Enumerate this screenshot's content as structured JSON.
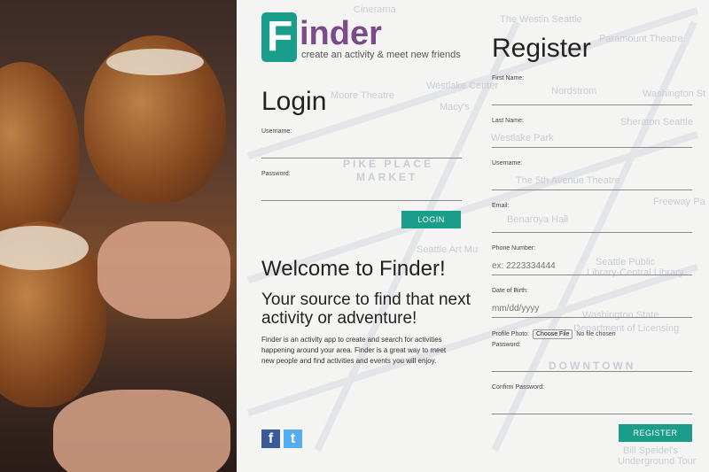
{
  "brand": {
    "logo_letter": "F",
    "logo_word": "inder",
    "tagline": "create an activity & meet new friends",
    "teal": "#1a9d8a",
    "purple": "#7a4a8a"
  },
  "login": {
    "title": "Login",
    "username_label": "Username:",
    "password_label": "Password:",
    "button": "LOGIN"
  },
  "welcome": {
    "title": "Welcome to Finder!",
    "subtitle": "Your source to find that next activity or adventure!",
    "body": "Finder is an activity app to create and search for activities happening around your area. Finder is a great way to meet new people and find activities and events you will enjoy."
  },
  "social": {
    "facebook_icon": "facebook-icon",
    "facebook_glyph": "f",
    "twitter_icon": "twitter-icon",
    "twitter_glyph": "t"
  },
  "register": {
    "title": "Register",
    "first_name_label": "First Name:",
    "last_name_label": "Last Name:",
    "username_label": "Username:",
    "email_label": "Email:",
    "phone_label": "Phone Number:",
    "phone_placeholder": "ex: 2223334444",
    "dob_label": "Date of Birth:",
    "dob_placeholder": "mm/dd/yyyy",
    "photo_label": "Profile Photo:",
    "choose_file": "Choose File",
    "no_file": "No file chosen",
    "password_label": "Password:",
    "confirm_label": "Confirm Password:",
    "button": "REGISTER"
  },
  "map_labels": {
    "cinerama": "Cinerama",
    "westin": "The Westin Seattle",
    "paramount": "Paramount Theatre",
    "westlake": "Westlake Center",
    "nordstrom": "Nordstrom",
    "washington": "Washington St",
    "moore": "Moore Theatre",
    "macys": "Macy's",
    "sheraton": "Sheraton Seattle",
    "westlake_park": "Westlake Park",
    "pike_place": "PIKE PLACE",
    "market": "MARKET",
    "fifth_ave": "The 5th Avenue Theatre",
    "freeway": "Freeway Pa",
    "benaroya": "Benaroya Hall",
    "art_museum": "Seattle Art Mu",
    "public_library": "Seattle Public",
    "library_central": "Library-Central Library",
    "washington_state": "Washington State",
    "licensing": "Department of Licensing",
    "downtown": "DOWNTOWN",
    "bill_speidel": "Bill Speidel's",
    "underground": "Underground Tour"
  }
}
